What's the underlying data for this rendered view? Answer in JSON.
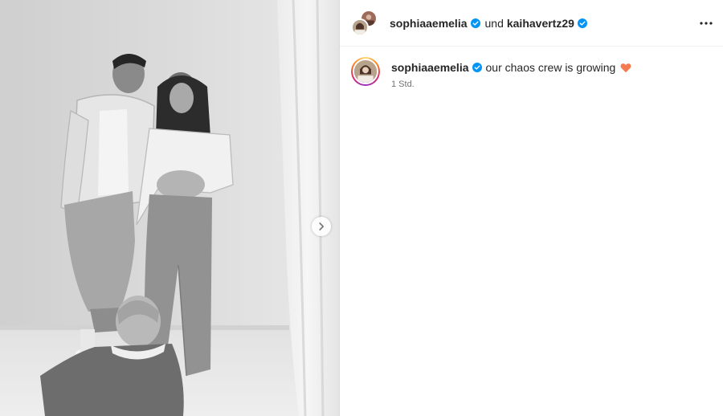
{
  "header": {
    "author": "sophiaaemelia",
    "conjunction": "und",
    "collaborator": "kaihavertz29"
  },
  "caption": {
    "username": "sophiaaemelia",
    "text": "our chaos crew is growing",
    "emoji_icon": "orange-heart-icon",
    "time": "1 Std."
  },
  "icons": {
    "verified": "verified-badge-icon",
    "more": "more-options-icon",
    "next": "chevron-right-icon"
  },
  "colors": {
    "verified_blue": "#0095f6",
    "heart_orange": "#f47b4f",
    "muted_text": "#737373"
  }
}
